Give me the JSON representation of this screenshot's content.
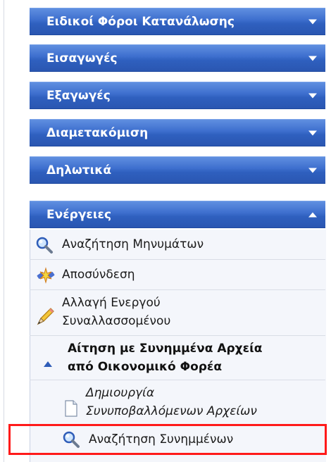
{
  "menu": {
    "sections": [
      {
        "label": "Ειδικοί Φόροι Κατανάλωσης",
        "state": "collapsed"
      },
      {
        "label": "Εισαγωγές",
        "state": "collapsed"
      },
      {
        "label": "Εξαγωγές",
        "state": "collapsed"
      },
      {
        "label": "Διαμετακόμιση",
        "state": "collapsed"
      },
      {
        "label": "Δηλωτικά",
        "state": "collapsed"
      },
      {
        "label": "Ενέργειες",
        "state": "expanded"
      }
    ],
    "actions": {
      "search_messages": {
        "label": "Αναζήτηση Μηνυμάτων",
        "icon": "magnifier-icon"
      },
      "disconnect": {
        "label": "Αποσύνδεση",
        "icon": "disconnect-plug-icon"
      },
      "change_trader": {
        "line1": "Αλλαγή Ενεργού",
        "line2": "Συναλλασσομένου",
        "icon": "pencil-icon"
      },
      "attachments_request": {
        "line1": "Αίτηση με Συνημμένα Αρχεία",
        "line2": "από Οικονομικό Φορέα",
        "icon": "triangle-up-icon"
      },
      "create_files": {
        "line1": "Δημιουργία",
        "line2": "Συνυποβαλλόμενων Αρχείων",
        "icon": "document-icon"
      },
      "search_attachments": {
        "label": "Αναζήτηση Συνημμένων",
        "icon": "magnifier-icon"
      }
    }
  },
  "colors": {
    "header_blue": "#3f70cf",
    "highlight_red": "#ff1a1a"
  }
}
